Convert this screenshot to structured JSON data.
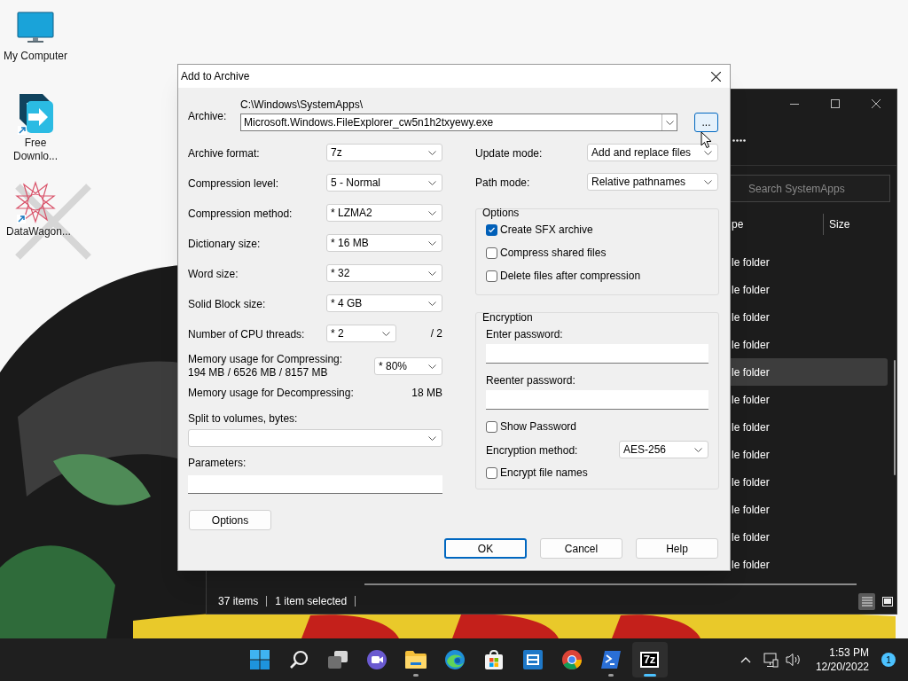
{
  "desktop_icons": [
    {
      "label": "My Computer",
      "kind": "monitor"
    },
    {
      "label": "Free Downlo...",
      "kind": "download"
    },
    {
      "label": "DataWagon...",
      "kind": "star"
    }
  ],
  "explorer": {
    "search_placeholder": "Search SystemApps",
    "columns": [
      "pe",
      "Size"
    ],
    "rows": [
      {
        "type": "le folder",
        "selected": false
      },
      {
        "type": "le folder",
        "selected": false
      },
      {
        "type": "le folder",
        "selected": false
      },
      {
        "type": "le folder",
        "selected": false
      },
      {
        "type": "le folder",
        "selected": true
      },
      {
        "type": "le folder",
        "selected": false
      },
      {
        "type": "le folder",
        "selected": false
      },
      {
        "type": "le folder",
        "selected": false
      },
      {
        "type": "le folder",
        "selected": false
      },
      {
        "type": "le folder",
        "selected": false
      },
      {
        "type": "le folder",
        "selected": false
      },
      {
        "type": "le folder",
        "selected": false
      }
    ],
    "status": [
      "37 items",
      "1 item selected"
    ],
    "views": [
      {
        "kind": "details",
        "selected": true
      },
      {
        "kind": "tiles",
        "selected": false
      }
    ]
  },
  "dialog": {
    "title": "Add to Archive",
    "archive": {
      "label": "Archive:",
      "path": "C:\\Windows\\SystemApps\\",
      "value": "Microsoft.Windows.FileExplorer_cw5n1h2txyewy.exe",
      "browse": "..."
    },
    "left_fields": [
      {
        "label": "Archive format:",
        "value": "7z"
      },
      {
        "label": "Compression level:",
        "value": "5 - Normal"
      },
      {
        "label": "Compression method:",
        "value": "* LZMA2"
      },
      {
        "label": "Dictionary size:",
        "value": "* 16 MB"
      },
      {
        "label": "Word size:",
        "value": "* 32"
      },
      {
        "label": "Solid Block size:",
        "value": "* 4 GB"
      },
      {
        "label": "Number of CPU threads:",
        "value": "* 2",
        "suffix": "/ 2"
      }
    ],
    "memory_compress": {
      "label": "Memory usage for Compressing:",
      "detail": "194 MB / 6526 MB / 8157 MB",
      "value": "* 80%"
    },
    "memory_decompress": {
      "label": "Memory usage for Decompressing:",
      "value": "18 MB"
    },
    "split": {
      "label": "Split to volumes, bytes:"
    },
    "parameters": {
      "label": "Parameters:"
    },
    "options_button": "Options",
    "right_fields": [
      {
        "label": "Update mode:",
        "value": "Add and replace files"
      },
      {
        "label": "Path mode:",
        "value": "Relative pathnames"
      }
    ],
    "options_group": {
      "title": "Options",
      "checkboxes": [
        {
          "label": "Create SFX archive",
          "checked": true
        },
        {
          "label": "Compress shared files",
          "checked": false
        },
        {
          "label": "Delete files after compression",
          "checked": false
        }
      ]
    },
    "encryption": {
      "title": "Encryption",
      "enter_label": "Enter password:",
      "reenter_label": "Reenter password:",
      "show_password": {
        "label": "Show Password",
        "checked": false
      },
      "method_label": "Encryption method:",
      "method": "AES-256",
      "encrypt_names": {
        "label": "Encrypt file names",
        "checked": false
      }
    },
    "buttons": [
      {
        "label": "OK",
        "default": true
      },
      {
        "label": "Cancel",
        "default": false
      },
      {
        "label": "Help",
        "default": false
      }
    ]
  },
  "taskbar": {
    "apps": [
      {
        "kind": "start",
        "running": false,
        "selected": false
      },
      {
        "kind": "search",
        "running": false,
        "selected": false
      },
      {
        "kind": "taskview",
        "running": false,
        "selected": false
      },
      {
        "kind": "chat",
        "running": false,
        "selected": false
      },
      {
        "kind": "folder",
        "running": true,
        "selected": false
      },
      {
        "kind": "edge",
        "running": false,
        "selected": false
      },
      {
        "kind": "store",
        "running": false,
        "selected": false
      },
      {
        "kind": "cabinet",
        "running": false,
        "selected": false
      },
      {
        "kind": "chrome",
        "running": false,
        "selected": false
      },
      {
        "kind": "terminal",
        "running": true,
        "selected": false
      },
      {
        "kind": "sevenzip",
        "text": "7z",
        "running": true,
        "selected": true
      }
    ],
    "time": "1:53 PM",
    "date": "12/20/2022",
    "notifications": "1"
  }
}
